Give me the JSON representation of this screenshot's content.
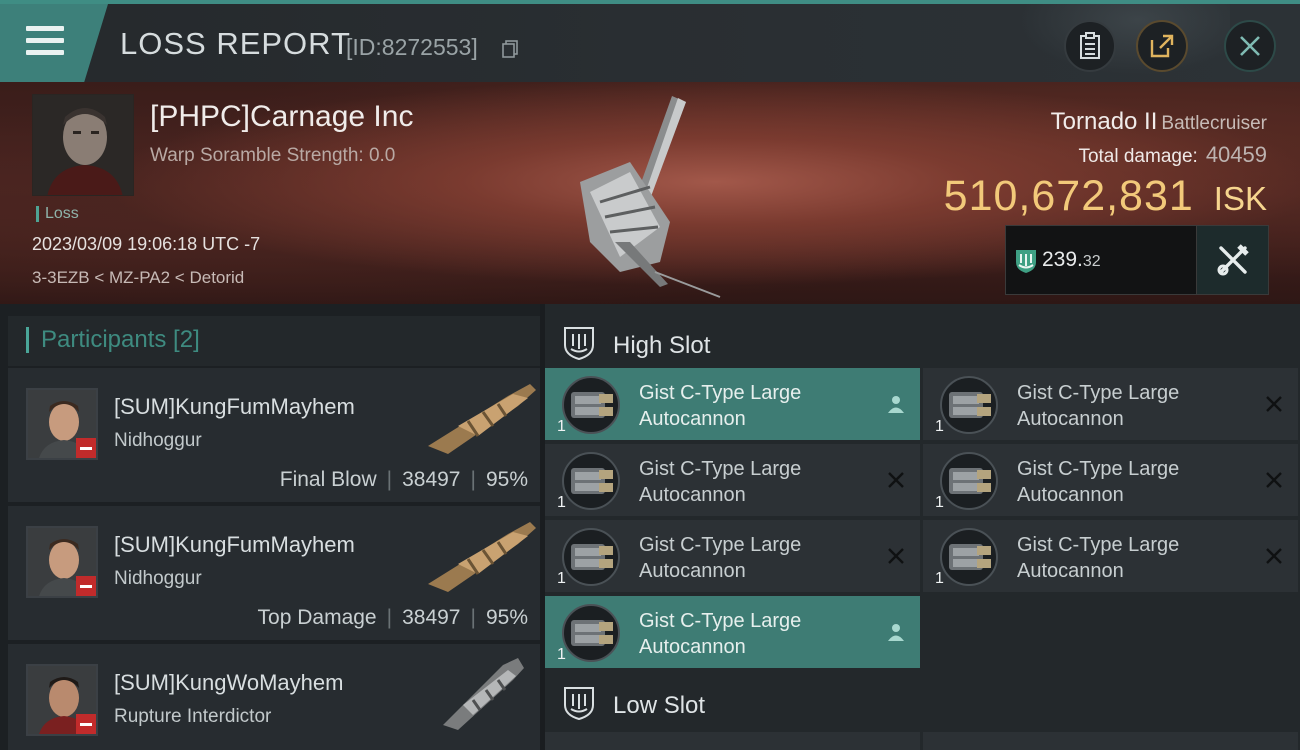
{
  "header": {
    "title": "LOSS REPORT",
    "id": "[ID:8272553]"
  },
  "victim": {
    "name": "[PHPC]Carnage Inc",
    "warp_scramble": "Warp Soramble Strength: 0.0",
    "status": "Loss",
    "timestamp": "2023/03/09 19:06:18 UTC -7",
    "location": "3-3EZB < MZ-PA2 < Detorid"
  },
  "ship": {
    "name": "Tornado II",
    "class": "Battlecruiser",
    "total_damage_label": "Total damage:",
    "total_damage": "40459",
    "isk_value": "510,672,831",
    "isk_unit": "ISK",
    "value_int": "239.",
    "value_dec": "32"
  },
  "participants": {
    "title": "Participants [2]",
    "rows": [
      {
        "name": "[SUM]KungFumMayhem",
        "ship": "Nidhoggur",
        "role": "Final Blow",
        "damage": "38497",
        "percent": "95%"
      },
      {
        "name": "[SUM]KungFumMayhem",
        "ship": "Nidhoggur",
        "role": "Top Damage",
        "damage": "38497",
        "percent": "95%"
      },
      {
        "name": "[SUM]KungWoMayhem",
        "ship": "Rupture Interdictor"
      }
    ]
  },
  "slots": {
    "high": {
      "label": "High Slot",
      "modules": [
        {
          "line1": "Gist C-Type Large",
          "line2": "Autocannon",
          "qty": "1",
          "status": "person-icon",
          "selected": true
        },
        {
          "line1": "Gist C-Type Large",
          "line2": "Autocannon",
          "qty": "1",
          "status": "x-icon",
          "selected": false
        },
        {
          "line1": "Gist C-Type Large",
          "line2": "Autocannon",
          "qty": "1",
          "status": "x-icon",
          "selected": false
        },
        {
          "line1": "Gist C-Type Large",
          "line2": "Autocannon",
          "qty": "1",
          "status": "x-icon",
          "selected": false
        },
        {
          "line1": "Gist C-Type Large",
          "line2": "Autocannon",
          "qty": "1",
          "status": "x-icon",
          "selected": false
        },
        {
          "line1": "Gist C-Type Large",
          "line2": "Autocannon",
          "qty": "1",
          "status": "x-icon",
          "selected": false
        },
        {
          "line1": "Gist C-Type Large",
          "line2": "Autocannon",
          "qty": "1",
          "status": "person-icon",
          "selected": true
        }
      ]
    },
    "low": {
      "label": "Low Slot"
    }
  },
  "colors": {
    "accent": "#3e7c74",
    "isk": "#f2c97a",
    "loss_red": "#c12b2b"
  }
}
